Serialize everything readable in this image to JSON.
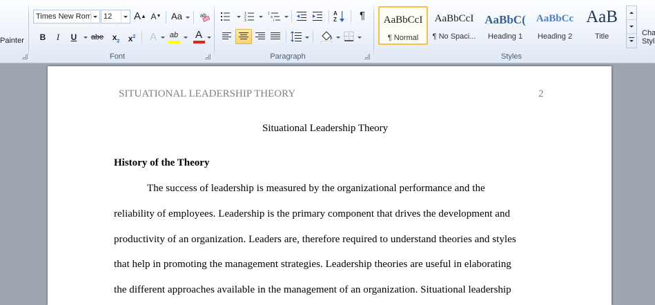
{
  "clipboard": {
    "painter_label": "Painter"
  },
  "font": {
    "group_label": "Font",
    "font_name": "Times New Rom",
    "font_size": "12",
    "grow_label": "A",
    "shrink_label": "A",
    "change_case_label": "Aa",
    "bold_label": "B",
    "italic_label": "I",
    "underline_label": "U",
    "strike_label": "abe",
    "subscript_label": "x",
    "superscript_label": "x",
    "subscript_digit": "2",
    "superscript_digit": "2",
    "highlight_label": "ab",
    "font_color_label": "A",
    "highlight_color": "#ffff00",
    "font_color": "#e0261b"
  },
  "paragraph": {
    "group_label": "Paragraph",
    "sort_top": "A",
    "sort_bottom": "Z",
    "show_marks": "¶"
  },
  "styles": {
    "group_label": "Styles",
    "items": [
      {
        "sample": "AaBbCcI",
        "name": "¶ Normal",
        "color": "#000000"
      },
      {
        "sample": "AaBbCcI",
        "name": "¶ No Spaci...",
        "color": "#000000"
      },
      {
        "sample": "AaBbC(",
        "name": "Heading 1",
        "color": "#365f91"
      },
      {
        "sample": "AaBbCc",
        "name": "Heading 2",
        "color": "#4f81bd"
      },
      {
        "sample": "AaB",
        "name": "Title",
        "color": "#17365d"
      }
    ],
    "change_styles_line1": "Cha",
    "change_styles_line2": "Styl"
  },
  "document": {
    "running_head": "SITUATIONAL LEADERSHIP THEORY",
    "page_number": "2",
    "title": "Situational Leadership Theory",
    "section_heading": "History of the Theory",
    "lines": [
      "The success of leadership is measured by the organizational performance and the",
      "reliability of employees. Leadership is the primary component that drives the development and",
      "productivity of an organization. Leaders are, therefore required to understand theories and styles",
      "that help in promoting the management strategies. Leadership theories are useful in elaborating",
      "the different approaches available in the management of an organization. Situational leadership"
    ]
  }
}
